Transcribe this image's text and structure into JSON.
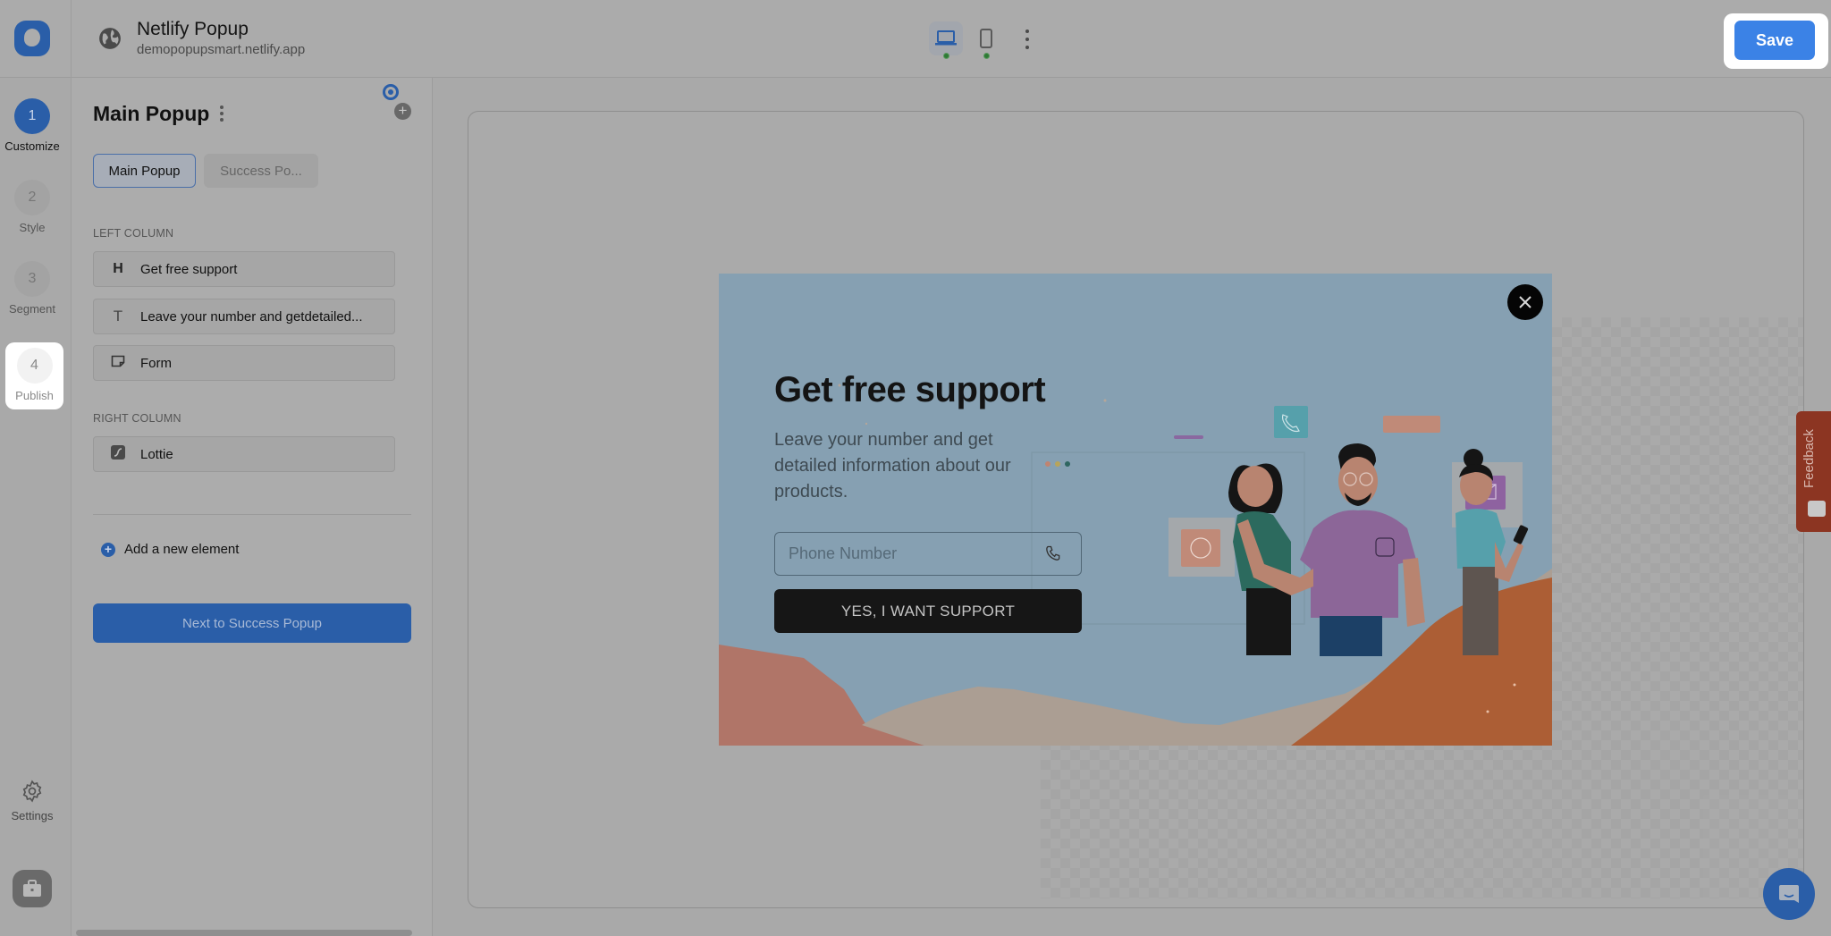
{
  "header": {
    "site_title": "Netlify Popup",
    "site_url": "demopopupsmart.netlify.app",
    "devices": [
      {
        "name": "desktop",
        "active": true,
        "status": "green"
      },
      {
        "name": "mobile",
        "active": false,
        "status": "green"
      }
    ],
    "save_label": "Save"
  },
  "steps": [
    {
      "number": "1",
      "label": "Customize",
      "state": "active"
    },
    {
      "number": "2",
      "label": "Style",
      "state": "inactive"
    },
    {
      "number": "3",
      "label": "Segment",
      "state": "inactive"
    },
    {
      "number": "4",
      "label": "Publish",
      "state": "highlighted"
    }
  ],
  "bottom_nav": {
    "settings_label": "Settings"
  },
  "panel": {
    "title": "Main Popup",
    "tabs": [
      {
        "label": "Main Popup",
        "active": true
      },
      {
        "label": "Success Po...",
        "active": false
      }
    ],
    "left_column_label": "LEFT COLUMN",
    "left_column_items": [
      {
        "icon": "H",
        "type": "heading",
        "label": "Get free support"
      },
      {
        "icon": "T",
        "type": "text",
        "label": "Leave your number and getdetailed..."
      },
      {
        "icon": "form-icon",
        "type": "form",
        "label": "Form"
      }
    ],
    "right_column_label": "RIGHT COLUMN",
    "right_column_items": [
      {
        "icon": "lottie-icon",
        "type": "lottie",
        "label": "Lottie"
      }
    ],
    "add_element_label": "Add a new element",
    "next_button_label": "Next to Success Popup"
  },
  "popup": {
    "heading": "Get free support",
    "description": "Leave your number and get detailed information about our products.",
    "phone_placeholder": "Phone Number",
    "cta_label": "YES, I WANT SUPPORT"
  },
  "feedback_label": "Feedback",
  "colors": {
    "accent": "#2a5ea8",
    "save_button": "#3b82e6",
    "popup_bg": "#86a0b2",
    "cta_bg": "#161616",
    "feedback_bg": "#8c3522"
  }
}
